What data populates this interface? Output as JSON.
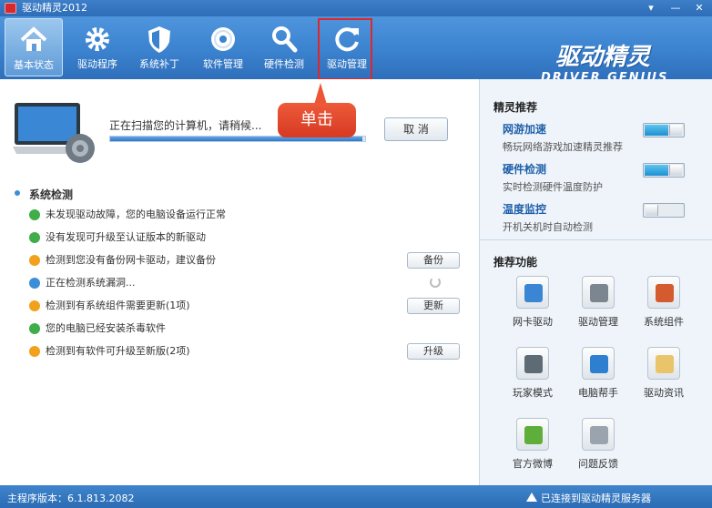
{
  "window": {
    "title": "驱动精灵2012",
    "controls": [
      "▾",
      "—",
      "✕"
    ]
  },
  "toolbar": {
    "tabs": [
      {
        "label": "基本状态",
        "icon": "home-icon",
        "active": true
      },
      {
        "label": "驱动程序",
        "icon": "gear-icon",
        "active": false
      },
      {
        "label": "系统补丁",
        "icon": "shield-icon",
        "active": false
      },
      {
        "label": "软件管理",
        "icon": "disc-icon",
        "active": false
      },
      {
        "label": "硬件检测",
        "icon": "magnifier-icon",
        "active": false
      },
      {
        "label": "驱动管理",
        "icon": "refresh-icon",
        "active": false
      }
    ],
    "brand_cn": "驱动精灵",
    "brand_en": "DRIVER GENIUS"
  },
  "scan": {
    "text": "正在扫描您的计算机，请稍候...",
    "progress": 0.99,
    "cancel_label": "取 消"
  },
  "callout": {
    "text": "单击"
  },
  "system_check": {
    "title": "系统检测",
    "rows": [
      {
        "text": "未发现驱动故障，您的电脑设备运行正常",
        "status": "ok",
        "button": ""
      },
      {
        "text": "没有发现可升级至认证版本的新驱动",
        "status": "ok",
        "button": ""
      },
      {
        "text": "检测到您没有备份网卡驱动，建议备份",
        "status": "warn",
        "button": "备份"
      },
      {
        "text": "正在检测系统漏洞...",
        "status": "info",
        "button": "",
        "spinner": true
      },
      {
        "text": "检测到有系统组件需要更新(1项)",
        "status": "warn",
        "button": "更新"
      },
      {
        "text": "您的电脑已经安装杀毒软件",
        "status": "ok",
        "button": ""
      },
      {
        "text": "检测到有软件可升级至新版(2项)",
        "status": "warn",
        "button": "升级"
      }
    ]
  },
  "recommend": {
    "title": "精灵推荐",
    "items": [
      {
        "name": "网游加速",
        "desc": "畅玩网络游戏加速精灵推荐",
        "on": true
      },
      {
        "name": "硬件检测",
        "desc": "实时检测硬件温度防护",
        "on": true
      },
      {
        "name": "温度监控",
        "desc": "开机关机时自动检测",
        "on": false
      }
    ]
  },
  "features": {
    "title": "推荐功能",
    "items": [
      {
        "label": "网卡驱动",
        "icon": "network-card-icon"
      },
      {
        "label": "驱动管理",
        "icon": "driver-gears-icon"
      },
      {
        "label": "系统组件",
        "icon": "system-tools-icon"
      },
      {
        "label": "玩家模式",
        "icon": "mixer-icon"
      },
      {
        "label": "电脑帮手",
        "icon": "users-icon"
      },
      {
        "label": "驱动资讯",
        "icon": "news-icon"
      },
      {
        "label": "官方微博",
        "icon": "weibo-icon"
      },
      {
        "label": "问题反馈",
        "icon": "feedback-icon"
      }
    ]
  },
  "status": {
    "version": "主程序版本：6.1.813.2082",
    "connected": "已连接到驱动精灵服务器"
  },
  "colors": {
    "accent": "#3b82cf",
    "callout": "#e2462b",
    "highlight": "#e0262a"
  }
}
